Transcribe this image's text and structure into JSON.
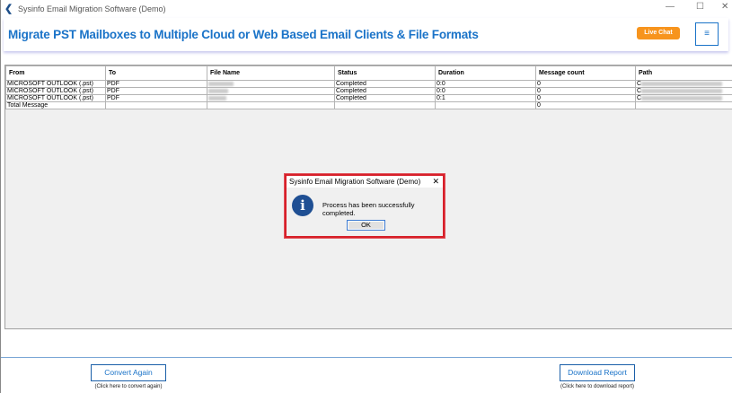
{
  "window": {
    "title": "Sysinfo Email Migration Software (Demo)"
  },
  "header": {
    "title": "Migrate PST Mailboxes to Multiple Cloud or Web Based Email Clients & File Formats",
    "live_chat": "Live Chat",
    "menu_icon": "hamburger-icon"
  },
  "table": {
    "columns": [
      "From",
      "To",
      "File Name",
      "Status",
      "Duration",
      "Message count",
      "Path"
    ],
    "rows": [
      {
        "from": "MICROSOFT OUTLOOK (.pst)",
        "to": "PDF",
        "status": "Completed",
        "duration": "0:0",
        "count": "0",
        "path": "C"
      },
      {
        "from": "MICROSOFT OUTLOOK (.pst)",
        "to": "PDF",
        "status": "Completed",
        "duration": "0:0",
        "count": "0",
        "path": "C"
      },
      {
        "from": "MICROSOFT OUTLOOK (.pst)",
        "to": "PDF",
        "status": "Completed",
        "duration": "0:1",
        "count": "0",
        "path": "C"
      }
    ],
    "total": {
      "label": "Total Message",
      "count": "0"
    }
  },
  "dialog": {
    "title": "Sysinfo Email Migration Software (Demo)",
    "message": "Process has been successfully completed.",
    "ok": "OK"
  },
  "footer": {
    "convert_again": "Convert Again",
    "convert_hint": "(Click here to convert again)",
    "download_report": "Download Report",
    "download_hint": "(Click here to download report)"
  }
}
